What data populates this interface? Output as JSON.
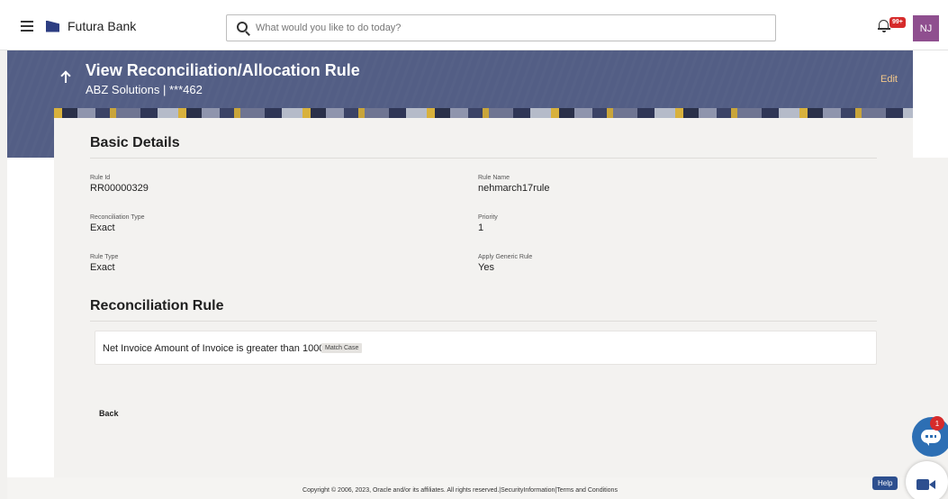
{
  "header": {
    "brand": "Futura Bank",
    "search_placeholder": "What would you like to do today?",
    "notification_count": "99+",
    "user_initials": "NJ"
  },
  "banner": {
    "title": "View Reconciliation/Allocation Rule",
    "subtitle": "ABZ Solutions | ***462",
    "edit_label": "Edit"
  },
  "basic_details": {
    "heading": "Basic Details",
    "rule_id": {
      "label": "Rule Id",
      "value": "RR00000329"
    },
    "rule_name": {
      "label": "Rule Name",
      "value": "nehmarch17rule"
    },
    "reconciliation_type": {
      "label": "Reconciliation Type",
      "value": "Exact"
    },
    "priority": {
      "label": "Priority",
      "value": "1"
    },
    "rule_type": {
      "label": "Rule Type",
      "value": "Exact"
    },
    "apply_generic_rule": {
      "label": "Apply Generic Rule",
      "value": "Yes"
    }
  },
  "reconciliation_rule": {
    "heading": "Reconciliation Rule",
    "rule_text": "Net Invoice Amount of Invoice is greater than 1000",
    "tag": "Match Case"
  },
  "actions": {
    "back_label": "Back"
  },
  "footer": {
    "copyright": "Copyright © 2006, 2023, Oracle and/or its affiliates. All rights reserved.|SecurityInformation|Terms and Conditions"
  },
  "widgets": {
    "chat_badge": "1",
    "help_label": "Help"
  },
  "colors": {
    "banner": "#535e85",
    "edit_link": "#f3c88a",
    "avatar": "#8f4f8f",
    "notification_badge": "#d62b2b"
  }
}
